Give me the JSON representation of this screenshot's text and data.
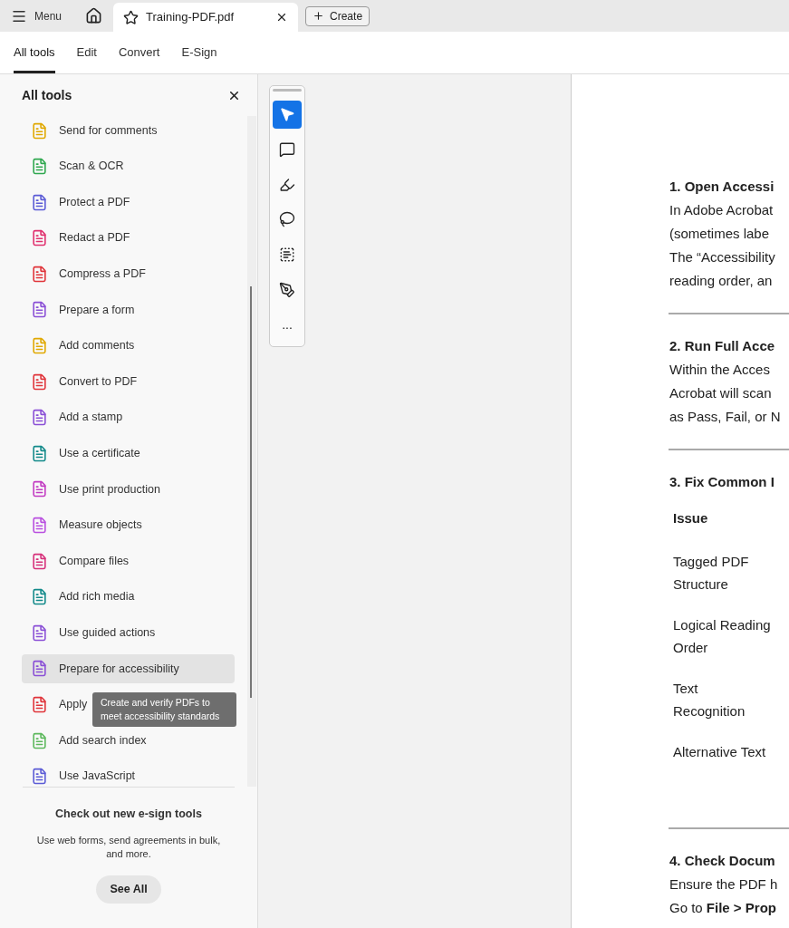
{
  "top_bar": {
    "menu_label": "Menu",
    "document_tab": {
      "title": "Training-PDF.pdf"
    },
    "create_label": "Create"
  },
  "tool_tabs": [
    {
      "label": "All tools",
      "selected": true
    },
    {
      "label": "Edit",
      "selected": false
    },
    {
      "label": "Convert",
      "selected": false
    },
    {
      "label": "E-Sign",
      "selected": false
    }
  ],
  "panel": {
    "title": "All tools",
    "items": [
      {
        "label": "Send for comments",
        "color": "#e0a800",
        "selected": false
      },
      {
        "label": "Scan & OCR",
        "color": "#2fa84f",
        "selected": false
      },
      {
        "label": "Protect a PDF",
        "color": "#5b5bd6",
        "selected": false
      },
      {
        "label": "Redact a PDF",
        "color": "#e0306e",
        "selected": false
      },
      {
        "label": "Compress a PDF",
        "color": "#e0343a",
        "selected": false
      },
      {
        "label": "Prepare a form",
        "color": "#8a4fd6",
        "selected": false
      },
      {
        "label": "Add comments",
        "color": "#e0a800",
        "selected": false
      },
      {
        "label": "Convert to PDF",
        "color": "#e0343a",
        "selected": false
      },
      {
        "label": "Add a stamp",
        "color": "#8a4fd6",
        "selected": false
      },
      {
        "label": "Use a certificate",
        "color": "#138a8a",
        "selected": false
      },
      {
        "label": "Use print production",
        "color": "#c23bc2",
        "selected": false
      },
      {
        "label": "Measure objects",
        "color": "#b94fe0",
        "selected": false
      },
      {
        "label": "Compare files",
        "color": "#d6307a",
        "selected": false
      },
      {
        "label": "Add rich media",
        "color": "#138a8a",
        "selected": false
      },
      {
        "label": "Use guided actions",
        "color": "#8a4fd6",
        "selected": false
      },
      {
        "label": "Prepare for accessibility",
        "color": "#8a4fd6",
        "selected": true
      },
      {
        "label": "Apply",
        "color": "#e0343a",
        "selected": false
      },
      {
        "label": "Add search index",
        "color": "#5cb85c",
        "selected": false
      },
      {
        "label": "Use JavaScript",
        "color": "#5b5bd6",
        "selected": false
      }
    ],
    "tooltip": "Create and verify PDFs to meet accessibility standards",
    "promo": {
      "title": "Check out new e-sign tools",
      "text": "Use web forms, send agreements in bulk, and more.",
      "button": "See All"
    }
  },
  "quick_tools": [
    {
      "kind": "select",
      "selected": true
    },
    {
      "kind": "comment",
      "selected": false
    },
    {
      "kind": "highlight",
      "selected": false
    },
    {
      "kind": "draw",
      "selected": false
    },
    {
      "kind": "text",
      "selected": false
    },
    {
      "kind": "sign",
      "selected": false
    },
    {
      "kind": "more",
      "label": "...",
      "selected": false
    }
  ],
  "document": {
    "sections": [
      {
        "heading": "1. Open Accessi",
        "lines": [
          "In Adobe Acrobat",
          "(sometimes labe",
          "The “Accessibility",
          "reading order, an"
        ]
      },
      {
        "heading": "2. Run Full Acce",
        "lines": [
          "Within the Acces",
          "Acrobat will scan",
          "as Pass, Fail, or N"
        ]
      },
      {
        "heading": "3. Fix Common I",
        "table": {
          "header": "Issue",
          "rows": [
            [
              "Tagged PDF",
              "Structure"
            ],
            [
              "Logical Reading",
              "Order"
            ],
            [
              "Text",
              "Recognition"
            ],
            [
              "Alternative Text"
            ]
          ]
        }
      },
      {
        "heading": "4. Check Docum",
        "lines": [
          "Ensure the PDF h",
          "Go to **File > Prop**"
        ]
      }
    ]
  }
}
